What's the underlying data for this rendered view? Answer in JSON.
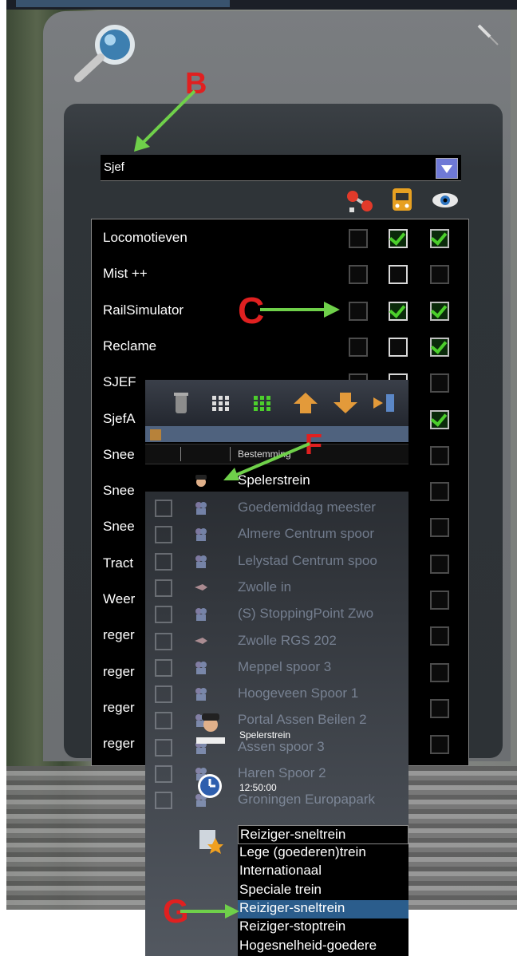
{
  "annotations": {
    "b": "B",
    "c": "C",
    "f": "F",
    "g": "G"
  },
  "layer_filter": {
    "selected": "Sjef"
  },
  "column_icons": [
    "signal-icon",
    "train-icon",
    "eye-icon"
  ],
  "layers": [
    {
      "label": "Locomotieven",
      "checks": [
        false,
        true,
        true
      ]
    },
    {
      "label": "Mist ++",
      "checks": [
        false,
        false,
        false
      ]
    },
    {
      "label": "RailSimulator",
      "checks": [
        false,
        true,
        true
      ]
    },
    {
      "label": "Reclame",
      "checks": [
        false,
        false,
        true
      ]
    },
    {
      "label": "SJEF",
      "checks": [
        false,
        false,
        false
      ]
    },
    {
      "label": "SjefA",
      "checks": [
        false,
        false,
        true
      ]
    },
    {
      "label": "Snee",
      "checks": [
        false,
        false,
        false
      ]
    },
    {
      "label": "Snee",
      "checks": [
        false,
        false,
        false
      ]
    },
    {
      "label": "Snee",
      "checks": [
        false,
        false,
        false
      ]
    },
    {
      "label": "Tract",
      "checks": [
        false,
        false,
        false
      ]
    },
    {
      "label": "Weer",
      "checks": [
        false,
        false,
        false
      ]
    },
    {
      "label": "reger",
      "checks": [
        false,
        false,
        false
      ]
    },
    {
      "label": "reger",
      "checks": [
        false,
        false,
        false
      ]
    },
    {
      "label": "reger",
      "checks": [
        false,
        false,
        false
      ]
    },
    {
      "label": "reger",
      "checks": [
        false,
        false,
        false
      ]
    }
  ],
  "orders_panel": {
    "column_header": "Bestemming",
    "player_train": "Spelerstrein",
    "rows": [
      "Goedemiddag meester",
      "Almere Centrum spoor",
      "Lelystad Centrum spoo",
      "Zwolle in",
      "(S) StoppingPoint Zwo",
      "Zwolle RGS 202",
      "Meppel spoor 3",
      "Hoogeveen Spoor 1",
      "Portal Assen Beilen 2",
      "Assen spoor 3",
      "Haren Spoor 2",
      "Groningen Europapark"
    ],
    "train_name": "Spelerstrein",
    "start_time": "12:50:00",
    "train_type_selected": "Reiziger-sneltrein",
    "train_type_options": [
      "Lege (goederen)trein",
      "Internationaal",
      "Speciale trein",
      "Reiziger-sneltrein",
      "Reiziger-stoptrein",
      "Hogesnelheid-goedere"
    ],
    "highlighted_option": "Reiziger-sneltrein"
  },
  "colors": {
    "check_green": "#4ccf2c",
    "annotation_red": "#e02020",
    "arrow_green": "#6fd04a",
    "highlight_blue": "#2b5d8c"
  }
}
